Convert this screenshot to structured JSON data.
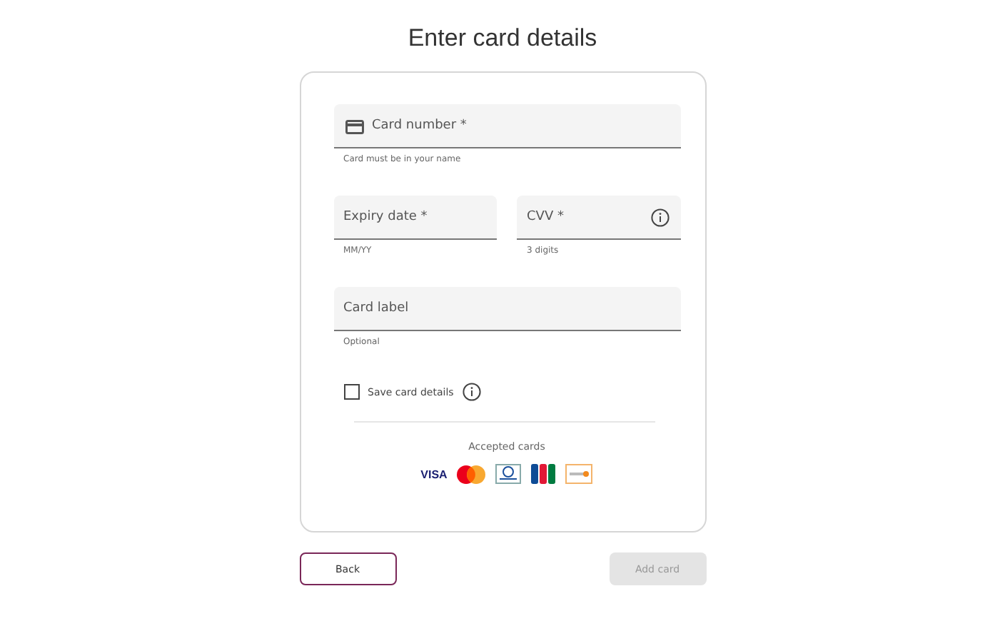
{
  "title": "Enter card details",
  "card_number": {
    "placeholder": "Card number *",
    "hint": "Card must be in your name"
  },
  "expiry": {
    "placeholder": "Expiry date *",
    "hint": "MM/YY"
  },
  "cvv": {
    "placeholder": "CVV *",
    "hint": "3 digits"
  },
  "card_label": {
    "placeholder": "Card label",
    "hint": "Optional"
  },
  "save_card": {
    "label": "Save card details",
    "checked": false
  },
  "accepted_cards": {
    "label": "Accepted cards",
    "visa": "VISA"
  },
  "buttons": [
    {
      "label": "Back",
      "kind": "secondary",
      "disabled": false
    },
    {
      "label": "Add card",
      "kind": "primary",
      "disabled": true
    }
  ]
}
